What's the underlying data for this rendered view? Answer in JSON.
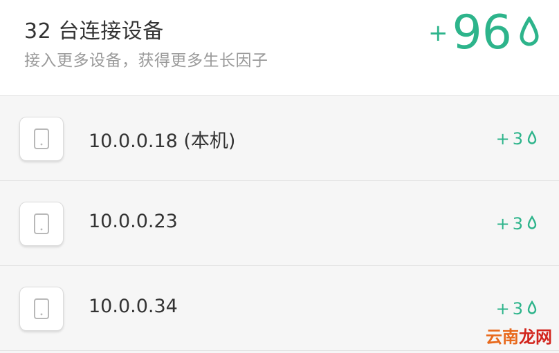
{
  "header": {
    "title": "32 台连接设备",
    "subtitle": "接入更多设备，获得更多生长因子",
    "total_sign": "+",
    "total_value": "96",
    "drop_icon": "water-drop-icon"
  },
  "devices": [
    {
      "label": "10.0.0.18 (本机)",
      "reward_sign": "+",
      "reward_value": "3",
      "icon": "tablet-icon"
    },
    {
      "label": "10.0.0.23",
      "reward_sign": "+",
      "reward_value": "3",
      "icon": "tablet-icon"
    },
    {
      "label": "10.0.0.34",
      "reward_sign": "+",
      "reward_value": "3",
      "icon": "tablet-icon"
    }
  ],
  "watermark": {
    "part1": "云南",
    "part2": "龙网"
  },
  "colors": {
    "accent": "#2db48b",
    "background": "#f6f6f6",
    "text": "#333333",
    "muted": "#9a9a9a"
  }
}
